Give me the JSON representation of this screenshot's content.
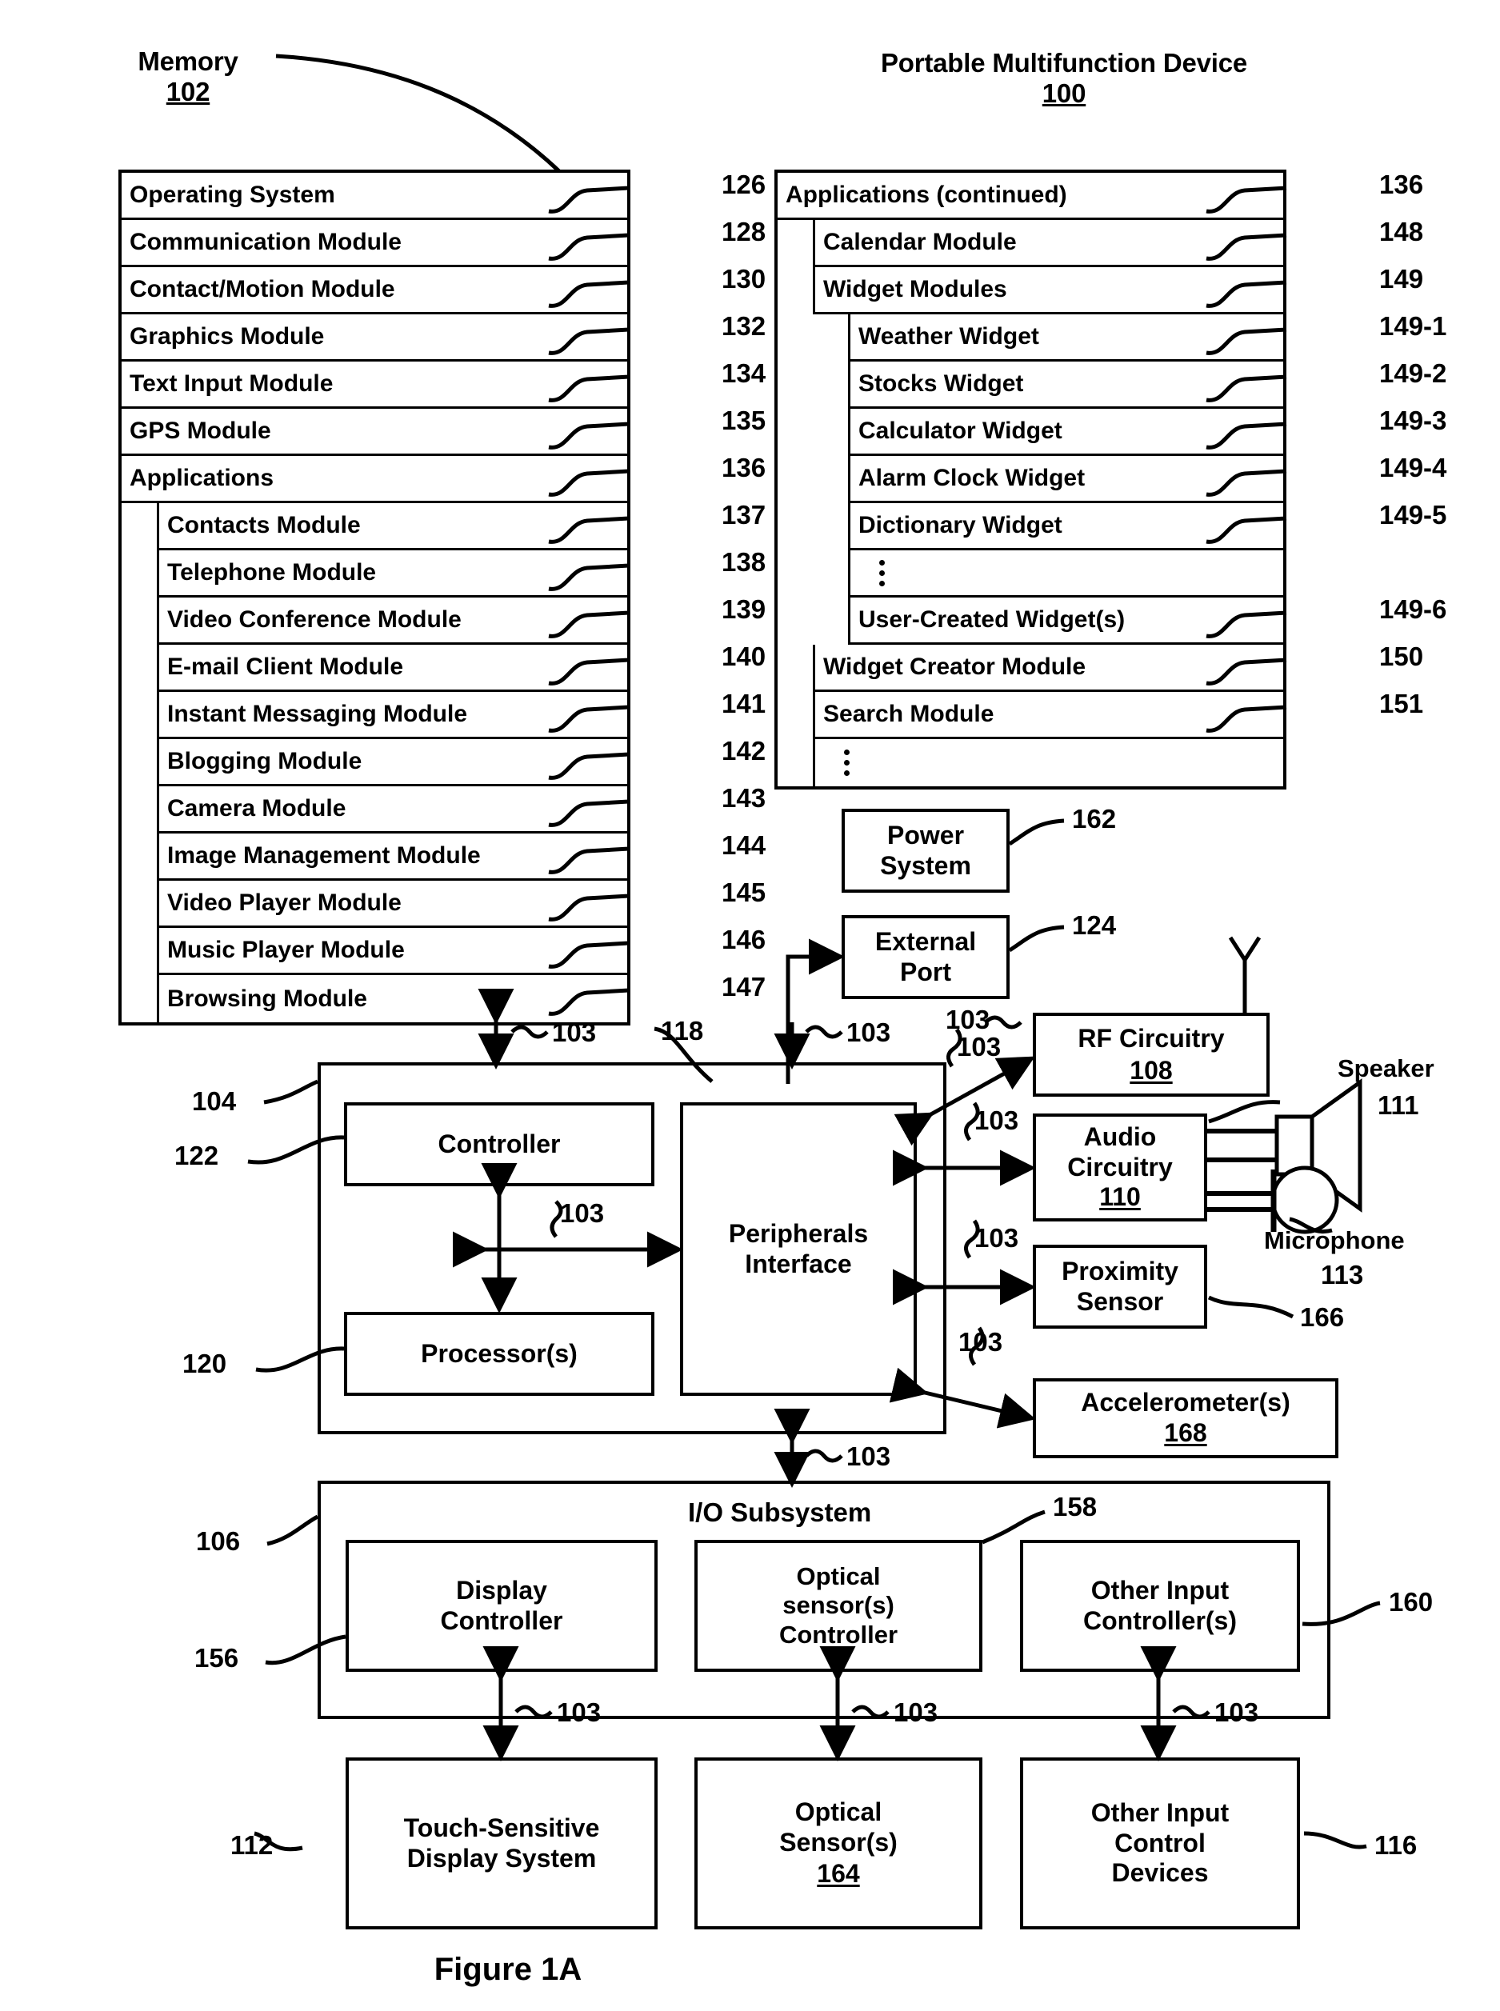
{
  "figure": {
    "caption": "Figure 1A"
  },
  "headings": {
    "memory_title": "Memory",
    "memory_ref": "102",
    "device_title": "Portable Multifunction Device",
    "device_ref": "100"
  },
  "memory_panel": {
    "rows": [
      {
        "label": "Operating System",
        "ref": "126",
        "indent": 0
      },
      {
        "label": "Communication Module",
        "ref": "128",
        "indent": 0
      },
      {
        "label": "Contact/Motion Module",
        "ref": "130",
        "indent": 0
      },
      {
        "label": "Graphics Module",
        "ref": "132",
        "indent": 0
      },
      {
        "label": "Text Input Module",
        "ref": "134",
        "indent": 0
      },
      {
        "label": "GPS Module",
        "ref": "135",
        "indent": 0
      },
      {
        "label": "Applications",
        "ref": "136",
        "indent": 0
      },
      {
        "label": "Contacts Module",
        "ref": "137",
        "indent": 1
      },
      {
        "label": "Telephone Module",
        "ref": "138",
        "indent": 1
      },
      {
        "label": "Video Conference Module",
        "ref": "139",
        "indent": 1
      },
      {
        "label": "E-mail Client Module",
        "ref": "140",
        "indent": 1
      },
      {
        "label": "Instant Messaging Module",
        "ref": "141",
        "indent": 1
      },
      {
        "label": "Blogging Module",
        "ref": "142",
        "indent": 1
      },
      {
        "label": "Camera Module",
        "ref": "143",
        "indent": 1
      },
      {
        "label": "Image Management Module",
        "ref": "144",
        "indent": 1
      },
      {
        "label": "Video Player Module",
        "ref": "145",
        "indent": 1
      },
      {
        "label": "Music Player Module",
        "ref": "146",
        "indent": 1
      },
      {
        "label": "Browsing Module",
        "ref": "147",
        "indent": 1
      }
    ]
  },
  "applications_panel": {
    "rows": [
      {
        "label": "Applications (continued)",
        "ref": "136",
        "indent": 0,
        "dots": false
      },
      {
        "label": "Calendar Module",
        "ref": "148",
        "indent": 1,
        "dots": false
      },
      {
        "label": "Widget Modules",
        "ref": "149",
        "indent": 1,
        "dots": false
      },
      {
        "label": "Weather Widget",
        "ref": "149-1",
        "indent": 2,
        "dots": false
      },
      {
        "label": "Stocks Widget",
        "ref": "149-2",
        "indent": 2,
        "dots": false
      },
      {
        "label": "Calculator Widget",
        "ref": "149-3",
        "indent": 2,
        "dots": false
      },
      {
        "label": "Alarm Clock Widget",
        "ref": "149-4",
        "indent": 2,
        "dots": false
      },
      {
        "label": "Dictionary Widget",
        "ref": "149-5",
        "indent": 2,
        "dots": false
      },
      {
        "label": "",
        "ref": "",
        "indent": 2,
        "dots": true
      },
      {
        "label": "User-Created Widget(s)",
        "ref": "149-6",
        "indent": 2,
        "dots": false
      },
      {
        "label": "Widget Creator Module",
        "ref": "150",
        "indent": 1,
        "dots": false
      },
      {
        "label": "Search Module",
        "ref": "151",
        "indent": 1,
        "dots": false
      },
      {
        "label": "",
        "ref": "",
        "indent": 1,
        "dots": true
      }
    ]
  },
  "blocks": {
    "power_system": {
      "label": "Power\nSystem",
      "ref": "162"
    },
    "external_port": {
      "label": "External\nPort",
      "ref": "124"
    },
    "rf_circuitry": {
      "label": "RF Circuitry",
      "ref": "108"
    },
    "audio_circuitry": {
      "label": "Audio\nCircuitry",
      "ref": "110"
    },
    "proximity_sensor": {
      "label": "Proximity\nSensor",
      "ref": "166"
    },
    "accelerometers": {
      "label": "Accelerometer(s)",
      "ref": "168"
    },
    "controller": {
      "label": "Controller",
      "ref": "122"
    },
    "processors": {
      "label": "Processor(s)",
      "ref": "120"
    },
    "peripherals": {
      "label": "Peripherals\nInterface",
      "ref": "118"
    },
    "cpu_group": {
      "ref": "104"
    },
    "io_subsystem": {
      "label": "I/O Subsystem",
      "ref": "106"
    },
    "display_controller": {
      "label": "Display\nController",
      "ref": "156"
    },
    "optical_controller": {
      "label": "Optical\nsensor(s)\nController",
      "ref": "158"
    },
    "other_input_controller": {
      "label": "Other Input\nController(s)",
      "ref": "160"
    },
    "touch_display": {
      "label": "Touch-Sensitive\nDisplay System",
      "ref": "112"
    },
    "optical_sensors": {
      "label": "Optical\nSensor(s)",
      "ref": "164"
    },
    "other_input_devices": {
      "label": "Other Input\nControl\nDevices",
      "ref": "116"
    }
  },
  "peripheral_labels": {
    "speaker": "Speaker",
    "speaker_ref": "111",
    "microphone": "Microphone",
    "microphone_ref": "113"
  },
  "bus_labels": {
    "bus": "103"
  }
}
